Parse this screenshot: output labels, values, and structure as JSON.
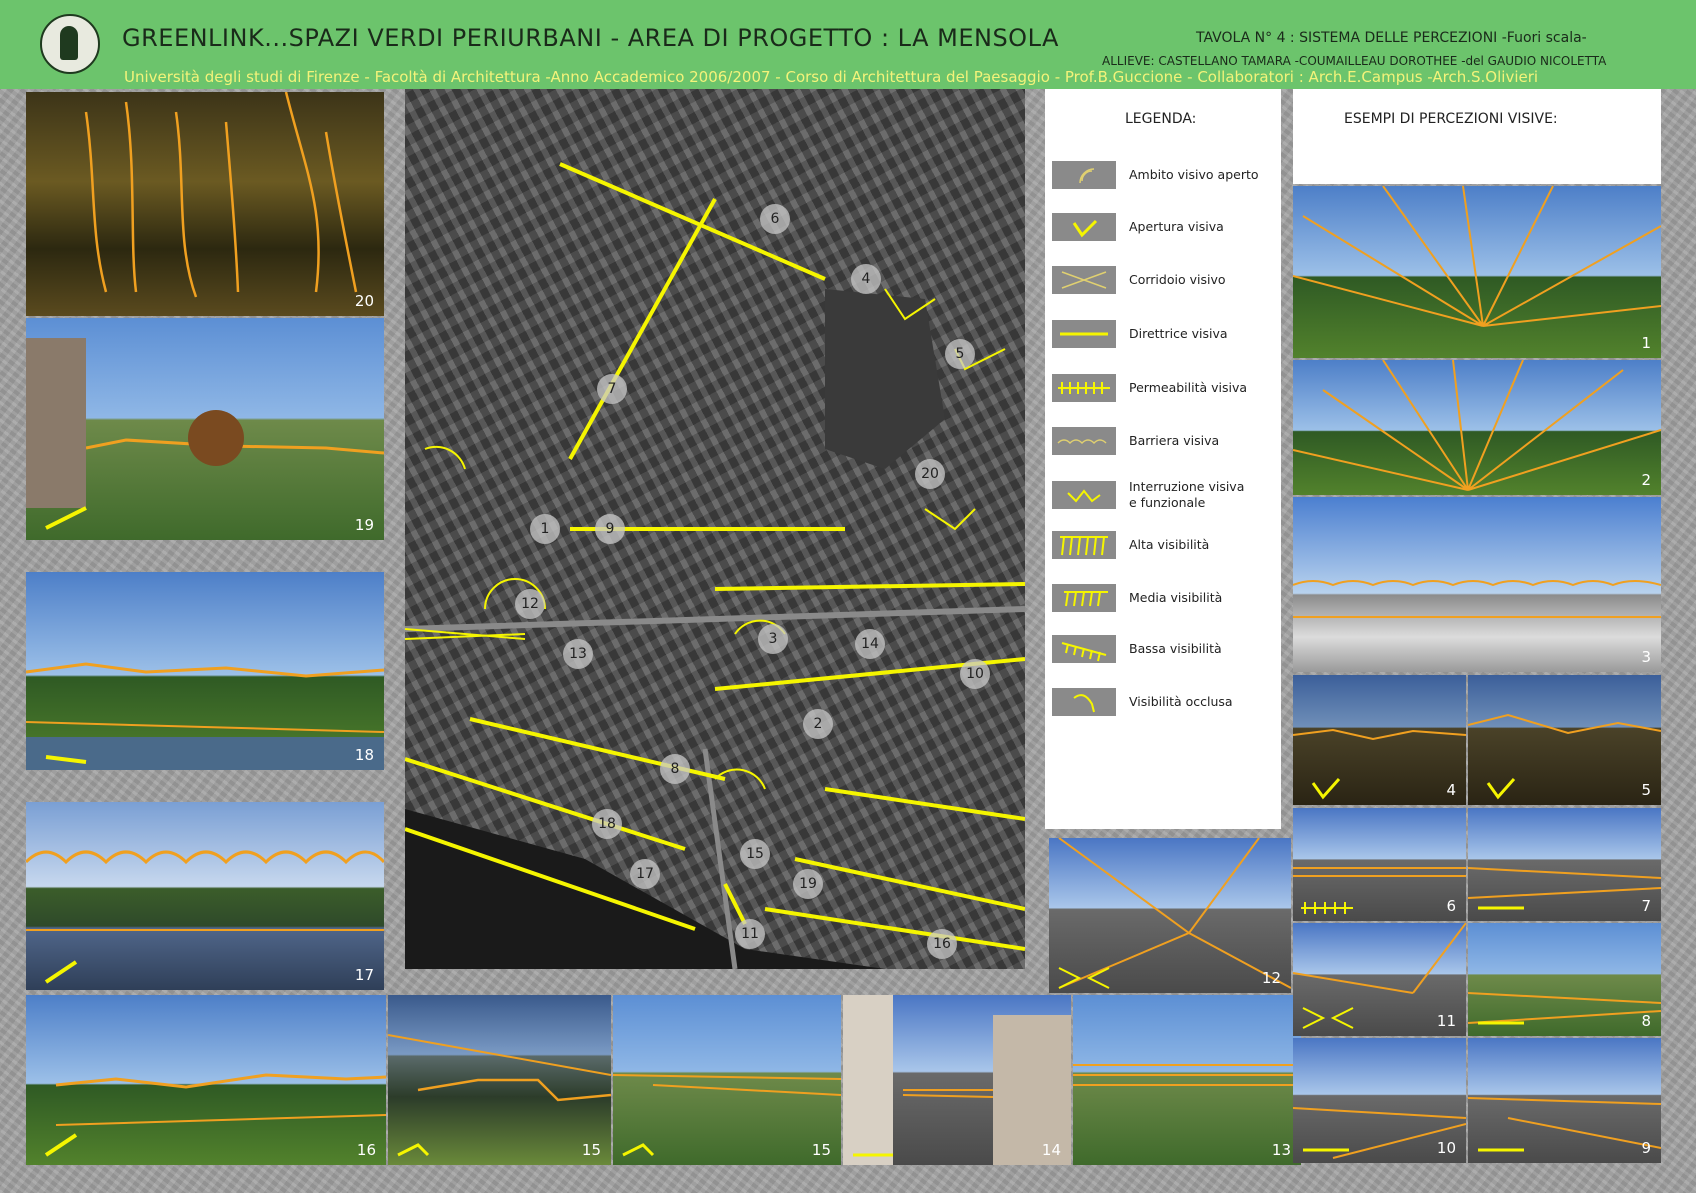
{
  "header": {
    "title": "GREENLINK...SPAZI VERDI PERIURBANI - AREA DI PROGETTO : LA MENSOLA",
    "tavola": "TAVOLA N° 4 : SISTEMA DELLE PERCEZIONI -Fuori scala-",
    "allievi": "ALLIEVE: CASTELLANO TAMARA -COUMAILLEAU DOROTHEE -del GAUDIO NICOLETTA",
    "subtitle": "Università degli studi di Firenze - Facoltà di Architettura -Anno Accademico 2006/2007 - Corso di Architettura del Paesaggio - Prof.B.Guccione - Collaboratori : Arch.E.Campus -Arch.S.Olivieri"
  },
  "legend": {
    "title": "LEGENDA:",
    "items": [
      "Ambito visivo aperto",
      "Apertura visiva",
      "Corridoio visivo",
      "Direttrice visiva",
      "Permeabilità visiva",
      "Barriera visiva",
      "Interruzione visiva\ne funzionale",
      "Alta visibilità",
      "Media visibilità",
      "Bassa visibilità",
      "Visibilità occlusa"
    ]
  },
  "esempi": {
    "title": "ESEMPI DI PERCEZIONI VISIVE:"
  },
  "photos": {
    "left": [
      "20",
      "19",
      "18",
      "17"
    ],
    "bottom": [
      "16",
      "15",
      "15",
      "14",
      "13"
    ],
    "right": [
      "1",
      "2",
      "3",
      "4",
      "5",
      "6",
      "7",
      "12",
      "11",
      "8",
      "10",
      "9"
    ]
  },
  "map_labels": [
    "1",
    "2",
    "3",
    "4",
    "5",
    "6",
    "7",
    "8",
    "9",
    "10",
    "11",
    "12",
    "13",
    "14",
    "15",
    "16",
    "17",
    "18",
    "19",
    "20"
  ],
  "colors": {
    "header": "#6cc46c",
    "accent": "#f5f500",
    "orange": "#f0a020"
  }
}
